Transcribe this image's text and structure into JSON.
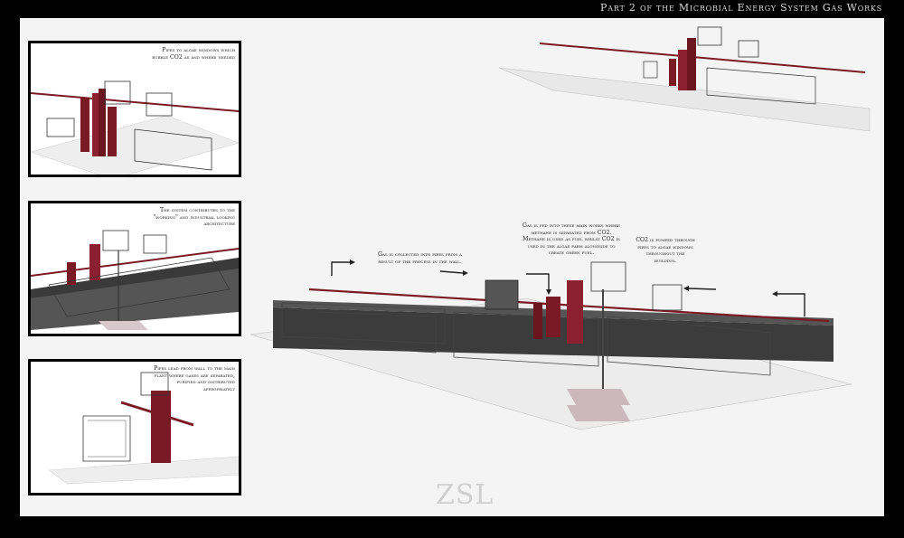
{
  "header": {
    "title": "Part 2 of the Microbial Energy System  Gas Works"
  },
  "panels": [
    {
      "caption": "Pipes to algae windows which bubble CO2 as and where needed"
    },
    {
      "caption": "The system contributes to the \"working\" and industrial looking architecture"
    },
    {
      "caption": "Pipes lead from wall to the main plant where gases are separated, purified and distributed appropriately"
    }
  ],
  "notes": {
    "collected": "Gas is collected into pipes from a result of the process in the wall.",
    "fed": "Gas is fed into these main works where methane is separated from CO2. Methane is used as fuel whilst CO2 is used in the algae farm alongside to create green fuel.",
    "pumped": "CO2 is pumped through pipes to algae windows throughout the building."
  },
  "logo": "ZSL",
  "colors": {
    "frame": "#000000",
    "sheet": "#f4f4f4",
    "pipe": "#7a1a24",
    "line": "#333333"
  }
}
